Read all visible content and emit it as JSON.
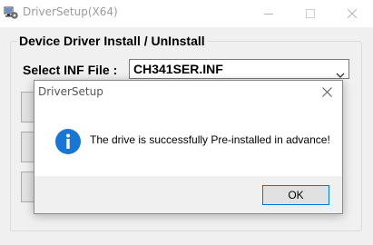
{
  "main_window": {
    "title": "DriverSetup(X64)",
    "icon": "driver-setup-app-icon",
    "controls": {
      "minimize_icon": "minimize-icon",
      "maximize_icon": "maximize-icon",
      "close_icon": "close-icon"
    }
  },
  "groupbox": {
    "title": "Device Driver Install / UnInstall",
    "select_label": "Select INF File :",
    "inf_file_value": "CH341SER.INF"
  },
  "dialog": {
    "title": "DriverSetup",
    "icon": "info-icon",
    "message": "The drive is successfully Pre-installed in advance!",
    "ok_label": "OK"
  },
  "colors": {
    "window_bg": "#f0f0f0",
    "titlebar_bg": "#ffffff",
    "info_icon_blue": "#1976d2",
    "ok_button_border": "#0078d7"
  }
}
